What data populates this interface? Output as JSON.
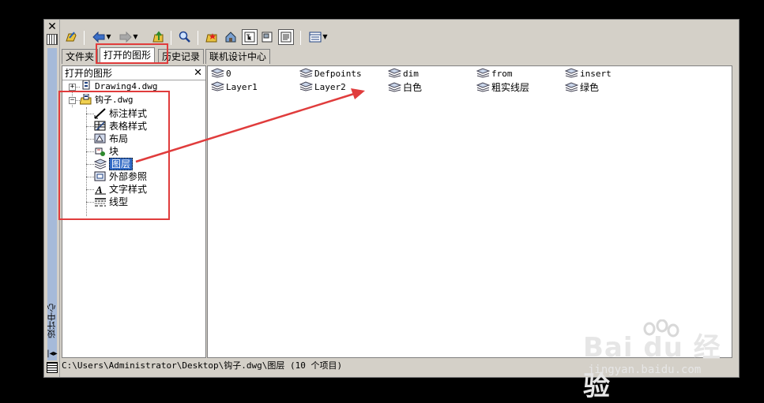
{
  "window": {
    "title": "设计中心",
    "close_glyph": "✕"
  },
  "tabs": [
    {
      "label": "文件夹"
    },
    {
      "label": "打开的图形"
    },
    {
      "label": "历史记录"
    },
    {
      "label": "联机设计中心"
    }
  ],
  "left_panel": {
    "header": "打开的图形",
    "close_glyph": "✕",
    "tree": {
      "doc1": {
        "label": "Drawing4.dwg",
        "expander": "+"
      },
      "doc2": {
        "label": "钩子.dwg",
        "expander": "−"
      },
      "children": [
        {
          "label": "标注样式",
          "icon": "dimension-style-icon"
        },
        {
          "label": "表格样式",
          "icon": "table-style-icon"
        },
        {
          "label": "布局",
          "icon": "layout-icon"
        },
        {
          "label": "块",
          "icon": "block-icon"
        },
        {
          "label": "图层",
          "icon": "layer-icon",
          "selected": true
        },
        {
          "label": "外部参照",
          "icon": "xref-icon"
        },
        {
          "label": "文字样式",
          "icon": "text-style-icon"
        },
        {
          "label": "线型",
          "icon": "linetype-icon"
        }
      ]
    }
  },
  "content": {
    "items": [
      {
        "label": "0"
      },
      {
        "label": "Defpoints"
      },
      {
        "label": "dim"
      },
      {
        "label": "from"
      },
      {
        "label": "insert"
      },
      {
        "label": "Layer1"
      },
      {
        "label": "Layer2"
      },
      {
        "label": "白色"
      },
      {
        "label": "粗实线层"
      },
      {
        "label": "绿色"
      }
    ]
  },
  "status": {
    "path": "C:\\Users\\Administrator\\Desktop\\钩子.dwg\\图层 (10 个项目)"
  },
  "toolbar": {
    "icons": [
      "load-icon",
      "back-icon",
      "forward-icon",
      "up-icon",
      "search-icon",
      "favorites-icon",
      "home-icon",
      "tree-toggle-icon",
      "preview-icon",
      "description-icon",
      "views-icon"
    ]
  },
  "watermark": {
    "brand": "Bai du 经验",
    "url": "jingyan.baidu.com"
  },
  "colors": {
    "annotation": "#e03c3c",
    "selection": "#316ac5",
    "panel_bg": "#d4d0c8",
    "background": "#000000"
  }
}
